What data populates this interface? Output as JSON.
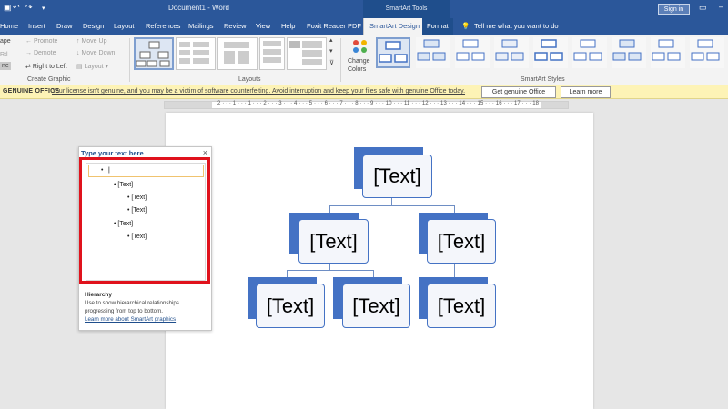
{
  "titlebar": {
    "document_title": "Document1 - Word",
    "context_group": "SmartArt Tools",
    "signin": "Sign in"
  },
  "tabs": [
    "Home",
    "Insert",
    "Draw",
    "Design",
    "Layout",
    "References",
    "Mailings",
    "Review",
    "View",
    "Help",
    "Foxit Reader PDF",
    "SmartArt Design",
    "Format"
  ],
  "tell_me": "Tell me what you want to do",
  "ribbon": {
    "create_graphic": {
      "shape_label": "ape",
      "promote": "Promote",
      "demote": "Demote",
      "move_up": "Move Up",
      "move_down": "Move Down",
      "rtl": "Right to Left",
      "layout": "Layout",
      "rtl_partial": "Rtl",
      "pane_partial": "ne",
      "group_label": "Create Graphic"
    },
    "layouts_label": "Layouts",
    "change_colors_1": "Change",
    "change_colors_2": "Colors",
    "styles_label": "SmartArt Styles"
  },
  "message_bar": {
    "label": "GENUINE OFFICE",
    "message": "Your license isn't genuine, and you may be a victim of software counterfeiting. Avoid interruption and keep your files safe with genuine Office today.",
    "btn_genuine": "Get genuine Office",
    "btn_learn": "Learn more"
  },
  "ruler": {
    "numbers": "2 · · · 1 · · · 1 · · · 2 · · · 3 · · · 4 · · · 5 · · · 6 · · · 7 · · · 8 · · · 9 · · · 10 · · · 11 · · · 12 · · · 13 · · · 14 · · · 15 · · · 16 · · · 17 · · · 18"
  },
  "text_pane": {
    "title": "Type your text here",
    "close": "×",
    "items": [
      "•",
      "• [Text]",
      "• [Text]",
      "• [Text]",
      "• [Text]",
      "• [Text]"
    ],
    "footer_title": "Hierarchy",
    "footer_desc": "Use to show hierarchical relationships progressing from top to bottom.",
    "footer_link": "Learn more about SmartArt graphics"
  },
  "diagram": {
    "root": "[Text]",
    "level2": [
      "[Text]",
      "[Text]"
    ],
    "level3": [
      "[Text]",
      "[Text]",
      "[Text]"
    ]
  },
  "colors": {
    "title_bar": "#2b579a",
    "shape_fill": "#4472c4",
    "highlight": "#e0121c",
    "warning_bar": "#fdf3b6"
  }
}
